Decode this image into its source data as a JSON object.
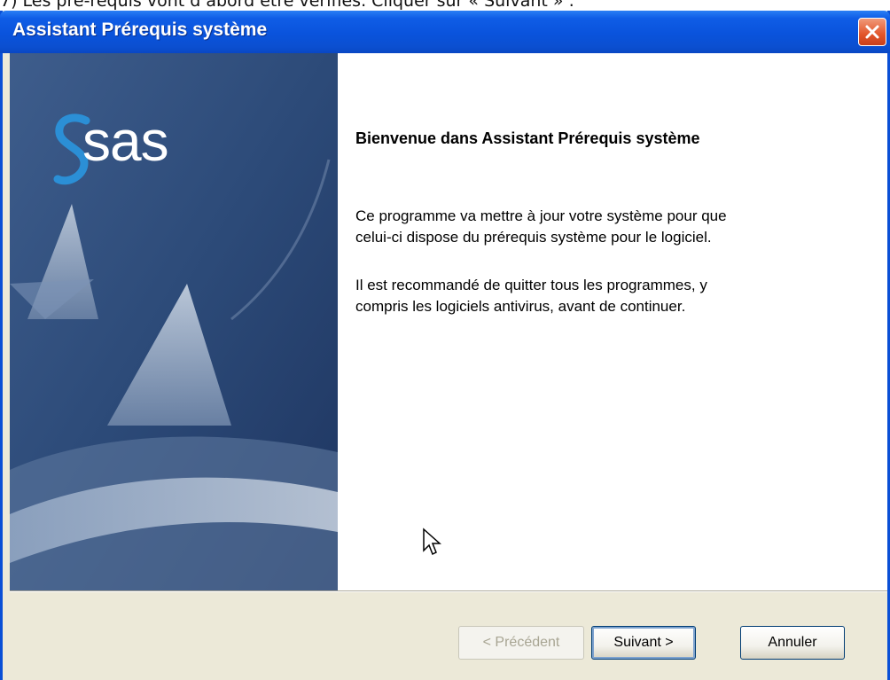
{
  "caption": "7) Les pré-requis vont d’abord être vérifiés. Cliquer sur « Suivant » :",
  "window": {
    "title": "Assistant Prérequis système",
    "close_icon": "close-icon"
  },
  "banner": {
    "logo_text": "sas",
    "logo_icon": "sas-logo-icon"
  },
  "content": {
    "heading": "Bienvenue dans Assistant Prérequis système",
    "paragraph1_line1": "Ce programme va mettre à jour votre système pour que",
    "paragraph1_line2": "celui-ci dispose du prérequis système pour le logiciel.",
    "paragraph2_line1": "Il est recommandé de quitter tous les programmes, y",
    "paragraph2_line2": "compris les logiciels antivirus, avant de continuer."
  },
  "buttons": {
    "back": "< Précédent",
    "next": "Suivant >",
    "cancel": "Annuler"
  },
  "colors": {
    "titlebar": "#0a53dc",
    "banner": "#2c4a78",
    "sas_blue": "#2b8fd6"
  }
}
